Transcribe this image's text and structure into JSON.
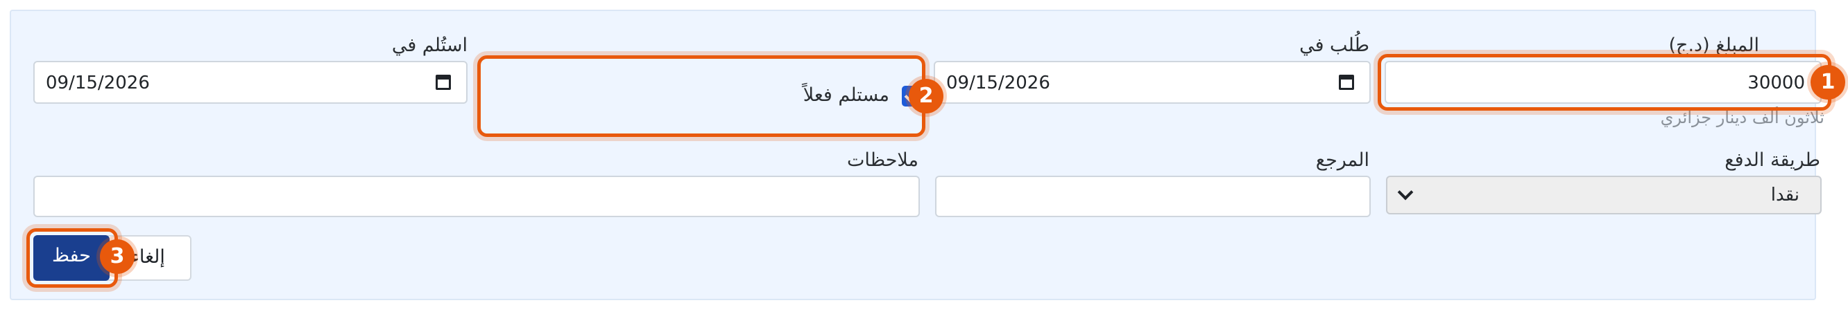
{
  "form": {
    "amount": {
      "label": "المبلغ (د.ج)",
      "value": "30000",
      "hint": "ثلاثون ألف دينار جزائري"
    },
    "requested_at": {
      "label": "طُلب في",
      "value": "09/15/2026"
    },
    "received_checkbox": {
      "label": "مستلم فعلاً",
      "checked": true
    },
    "received_at": {
      "label": "استُلم في",
      "value": "09/15/2026"
    },
    "payment_method": {
      "label": "طريقة الدفع",
      "selected": "نقدا"
    },
    "reference": {
      "label": "المرجع",
      "value": ""
    },
    "notes": {
      "label": "ملاحظات",
      "value": ""
    },
    "buttons": {
      "save": "حفظ",
      "cancel": "إلغاء"
    }
  },
  "annotations": {
    "step1": "1",
    "step2": "2",
    "step3": "3",
    "color": "#e8590c"
  },
  "colors": {
    "panel_bg": "#eef5ff",
    "primary_button": "#1a3f8f",
    "checkbox": "#1e5bd8"
  }
}
